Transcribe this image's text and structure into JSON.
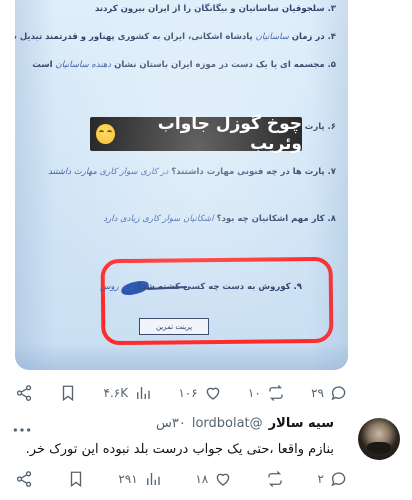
{
  "photo": {
    "lines": [
      {
        "text": "۳. سلجوقیان ساسانیان و بیگانگان را از ایران بیرون کردند",
        "hand": ""
      },
      {
        "text": "۴. در زمان ",
        "hand": "ساسانیان",
        "text2": " پادشاه اشکانی، ایران به کشوری پهناور و قدرتمند تبدیل شد"
      },
      {
        "text": "۵. مجسمه ای یا یک دست در موزه ایران باستان نشان ",
        "hand": "دهنده ساسانیان",
        "text2": " است"
      },
      {
        "text": "۶. پارت ها",
        "hand": ""
      },
      {
        "text": "۷. پارت ها در چه فنونی مهارت داشتند؟ ",
        "hand": "در کاری سوار کاری مهارت داشتند",
        "text2": ""
      },
      {
        "text": "۸. کار مهم اشکانیان چه بود؟ ",
        "hand": "اشکانیان سوار کاری زیادی دارد",
        "text2": ""
      },
      {
        "text": "۹. کوروش به دست چه کسی کشته شد؟ ",
        "hand": "ترم روس",
        "text2": ""
      }
    ],
    "caption": "چوخ گوزل جاواب وئریب",
    "print_button": "پرینت تمرین"
  },
  "post_actions": {
    "replies": "۲۹",
    "reposts": "۱۰",
    "likes": "۱۰۶",
    "views": "۴.۶K"
  },
  "reply": {
    "name": "سیه سالار",
    "handle": "@lordbolat",
    "time": "۳۰س",
    "text": "بنازم واقعا ،حتی یک جواب درست بلد نبوده این تورک خر.",
    "actions": {
      "replies": "۲",
      "reposts": "",
      "likes": "۱۸",
      "views": "۲۹۱"
    }
  },
  "icons": {
    "reply": "speech-bubble-icon",
    "repost": "repost-arrows-icon",
    "like": "heart-icon",
    "views": "bar-chart-icon",
    "bookmark": "bookmark-icon",
    "share": "share-icon",
    "more": "more-dots-icon"
  },
  "colors": {
    "annotation_red": "#ff2b2b",
    "icon_gray": "#536471",
    "text": "#0f1419"
  }
}
